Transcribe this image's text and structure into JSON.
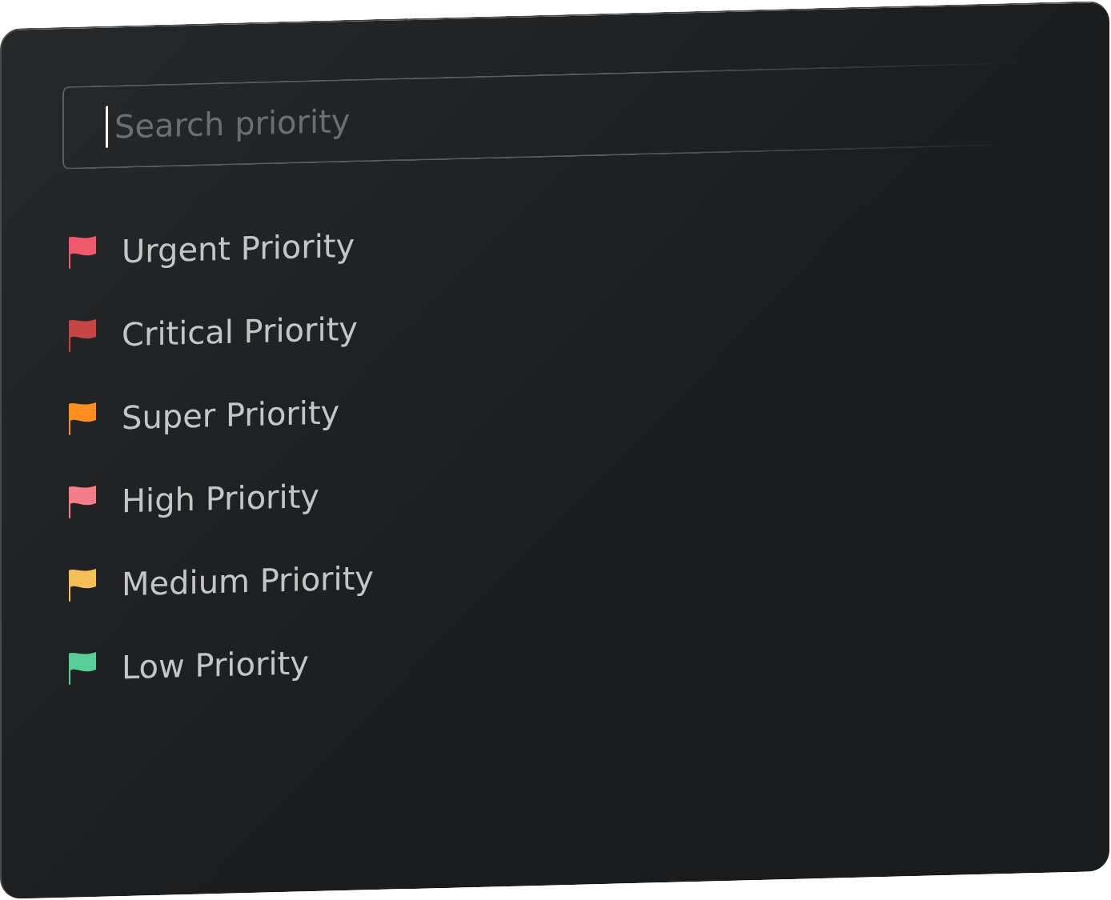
{
  "search": {
    "placeholder": "Search priority"
  },
  "priorities": [
    {
      "label": "Urgent Priority",
      "color": "#f0596b"
    },
    {
      "label": "Critical Priority",
      "color": "#c84443"
    },
    {
      "label": "Super Priority",
      "color": "#fd8e1f"
    },
    {
      "label": "High Priority",
      "color": "#f57d87"
    },
    {
      "label": "Medium Priority",
      "color": "#f7bd56"
    },
    {
      "label": "Low Priority",
      "color": "#57cf96"
    }
  ]
}
